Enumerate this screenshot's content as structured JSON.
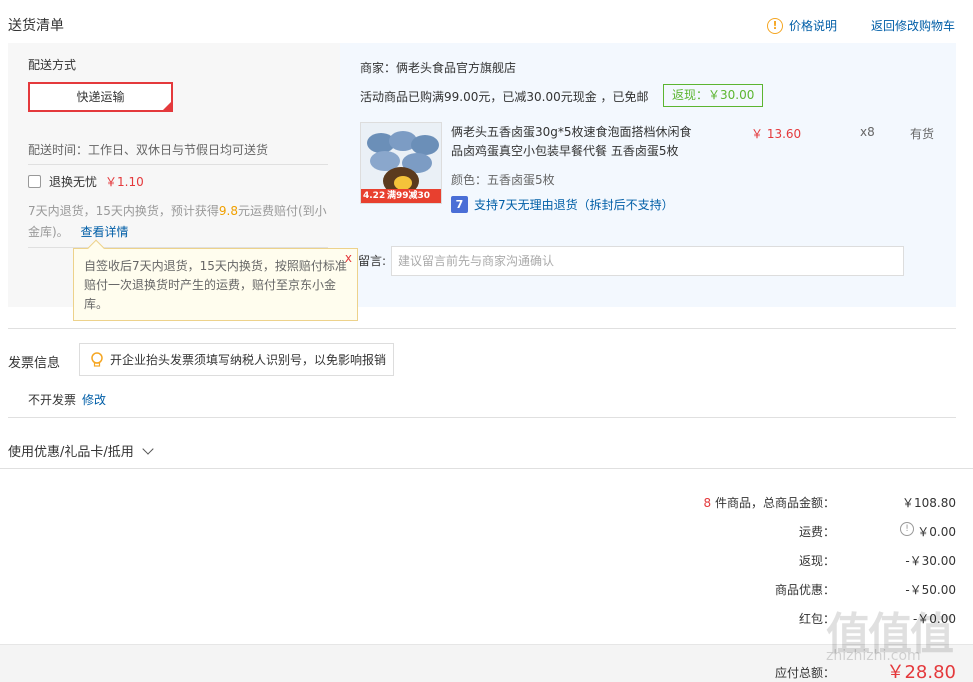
{
  "header": {
    "title": "送货清单",
    "price_info": "价格说明",
    "price_info_icon": "!",
    "back_to_cart": "返回修改购物车"
  },
  "shipping": {
    "method_label": "配送方式",
    "method_selected": "快递运输",
    "delivery_time": "配送时间：工作日、双休日与节假日均可送货",
    "return_service_label": "退换无忧",
    "return_service_price": "￥1.10",
    "return_note_prefix": "7天内退货，15天内换货，预计获得",
    "return_note_amount": "9.8",
    "return_note_suffix": "元运费赔付(到小金库)。",
    "view_details": "查看详情",
    "tooltip_text": "自签收后7天内退货，15天内换货，按照赔付标准赔付一次退换货时产生的运费，赔付至京东小金库。",
    "tooltip_close": "x"
  },
  "store": {
    "merchant": "商家：俩老头食品官方旗舰店",
    "promo": "活动商品已购满99.00元，已减30.00元现金 ，已免邮",
    "rebate_badge": "返现：￥30.00"
  },
  "product": {
    "title": "俩老头五香卤蛋30g*5枚速食泡面搭档休闲食品卤鸡蛋真空小包装早餐代餐 五香卤蛋5枚",
    "price": "￥ 13.60",
    "qty": "x8",
    "stock": "有货",
    "color": "颜色：五香卤蛋5枚",
    "support_icon": "7",
    "support_text": "支持7天无理由退货（拆封后不支持）",
    "thumb_badge_date": "4.22",
    "thumb_badge_text": "满99减30"
  },
  "message": {
    "label": "留言:",
    "placeholder": "建议留言前先与商家沟通确认"
  },
  "invoice": {
    "title": "发票信息",
    "tip": "开企业抬头发票须填写纳税人识别号，以免影响报销",
    "status": "不开发票",
    "modify": "修改"
  },
  "discount": {
    "label": "使用优惠/礼品卡/抵用"
  },
  "summary": {
    "count": "8",
    "count_suffix": "件商品，总商品金额：",
    "total_goods": "￥108.80",
    "shipping_label": "运费：",
    "shipping_val": "￥0.00",
    "rebate_label": "返现：",
    "rebate_val": "-￥30.00",
    "discount_label": "商品优惠：",
    "discount_val": "-￥50.00",
    "redpacket_label": "红包：",
    "redpacket_val": "-￥0.00",
    "payable_label": "应付总额：",
    "payable_val": "￥28.80"
  },
  "watermark": {
    "logo": "值值值",
    "site": "zhizhizhi.com"
  },
  "colors": {
    "accent": "#e4393c",
    "link": "#005ea7",
    "rebate": "#5cb531"
  }
}
